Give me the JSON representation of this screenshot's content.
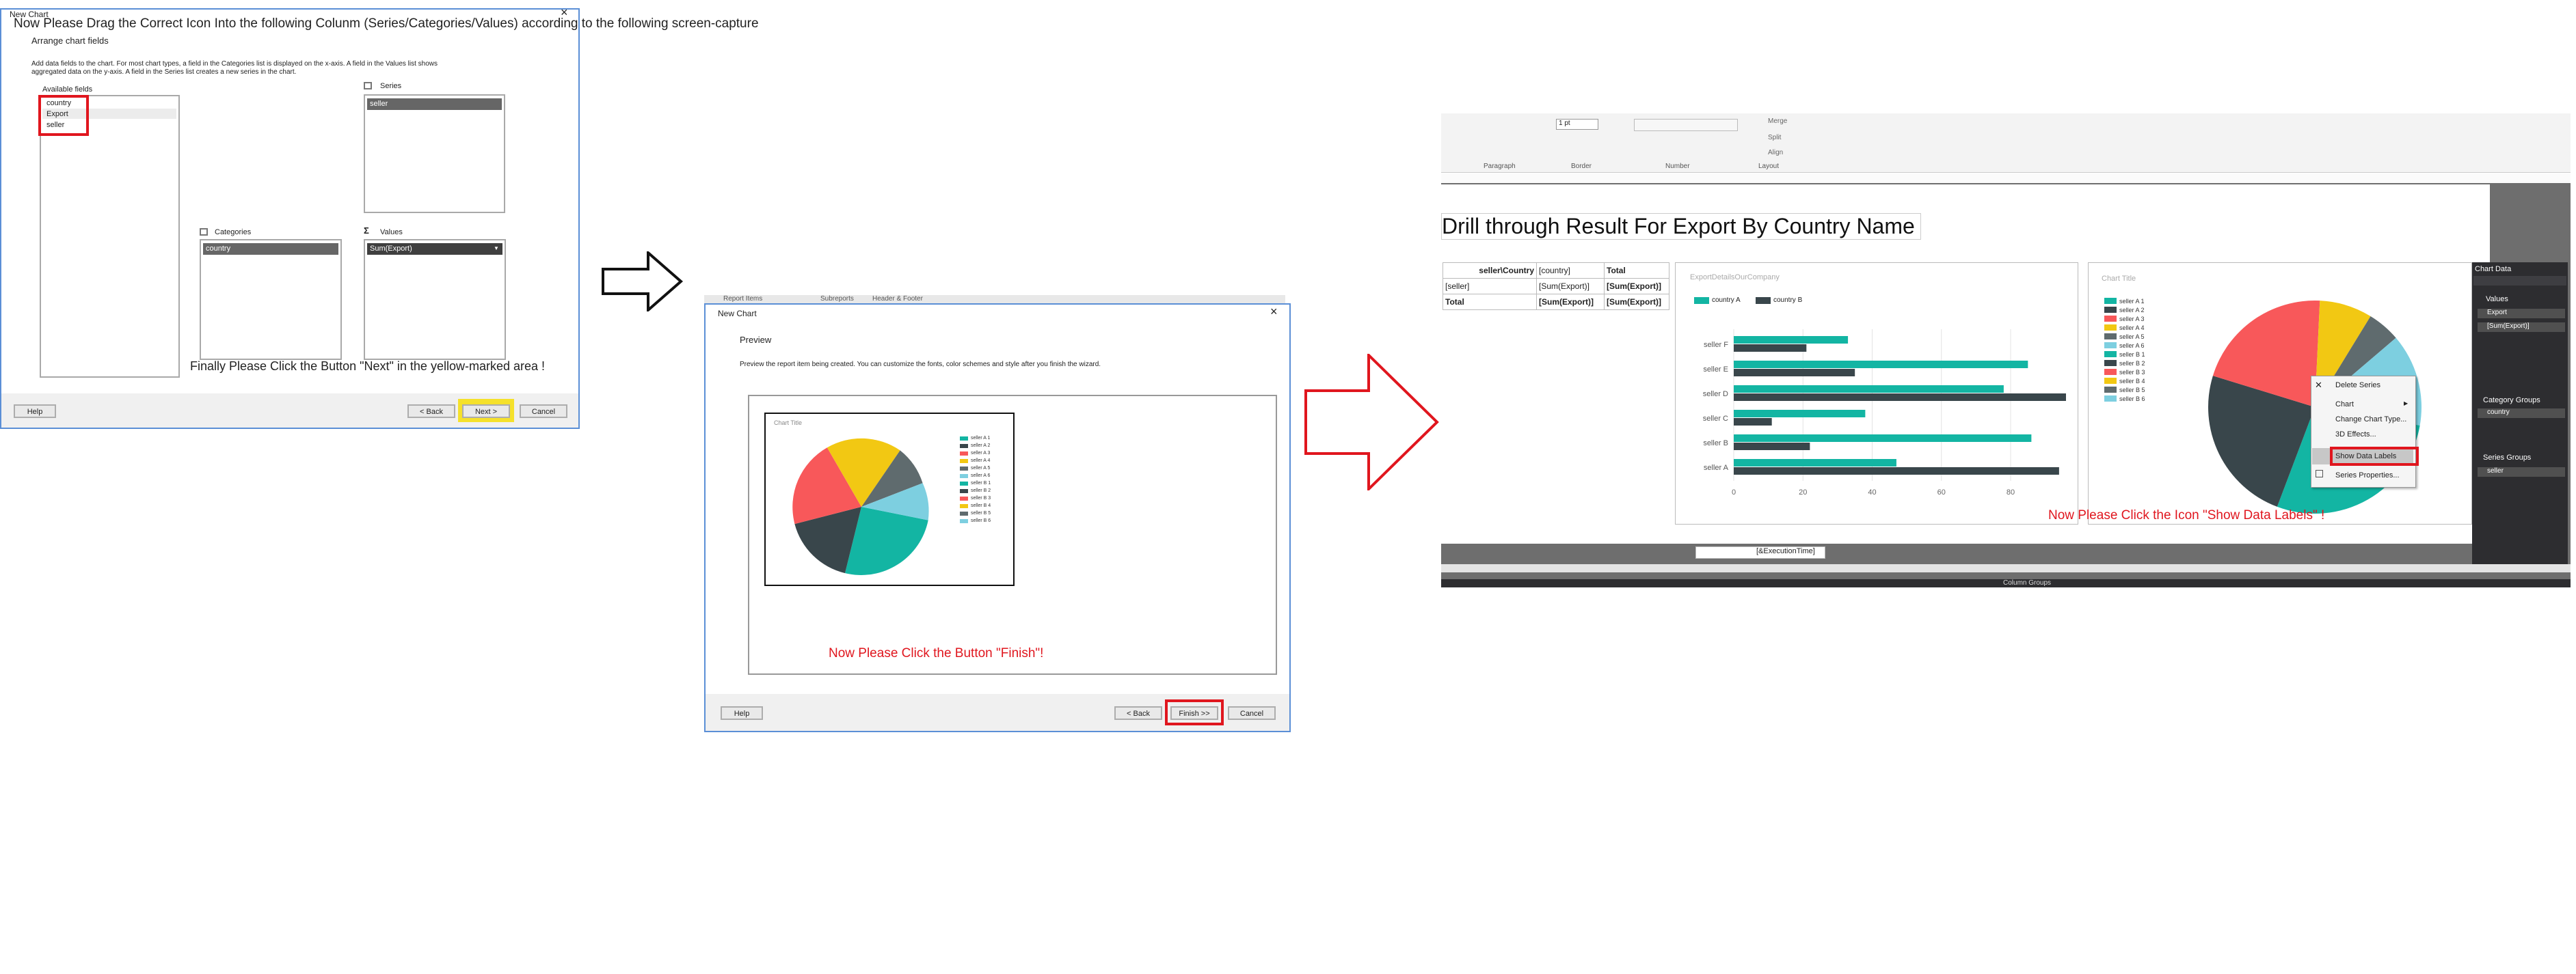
{
  "instructions": {
    "step1": "Now Please Drag the Correct Icon Into the following Colunm (Series/Categories/Values) according to the following screen-capture",
    "step2": "Finally Please Click the Button \"Next\" in the yellow-marked area !",
    "step3": "Now Please Click the Button \"Finish\"!",
    "step4": "Now Please Click the Icon \"Show Data Labels\" !"
  },
  "wizard1": {
    "title": "New Chart",
    "heading": "Arrange chart fields",
    "desc1": "Add data fields to the chart. For most chart types, a field in the Categories list is displayed on the x-axis. A field in the Values list shows",
    "desc2": "aggregated data on the y-axis. A field in the Series list creates a new series in the chart.",
    "available_label": "Available fields",
    "available_fields": [
      "country",
      "Export",
      "seller"
    ],
    "series_label": "Series",
    "series_item": "seller",
    "categories_label": "Categories",
    "categories_item": "country",
    "values_label": "Values",
    "values_item": "Sum(Export)",
    "help": "Help",
    "back": "< Back",
    "next": "Next >",
    "cancel": "Cancel",
    "close": "×"
  },
  "wizard2": {
    "title": "New Chart",
    "bg_tabs": [
      "Report Items",
      "Subreports",
      "Header & Footer"
    ],
    "heading": "Preview",
    "desc": "Preview the report item being created. You can customize the fonts, color schemes and style after you finish the wizard.",
    "chart_title": "Chart Title",
    "help": "Help",
    "back": "< Back",
    "finish": "Finish >>",
    "cancel": "Cancel",
    "close": "×"
  },
  "designer": {
    "ribbon": {
      "border_width": "1 pt",
      "merge": "Merge",
      "split": "Split",
      "align": "Align",
      "groups": [
        "Paragraph",
        "Border",
        "Number",
        "Layout"
      ]
    },
    "report_title": "Drill through Result For Export By Country Name",
    "table": {
      "header": [
        "seller\\Country",
        "[country]",
        "Total"
      ],
      "row1": [
        "[seller]",
        "[Sum(Export)]",
        "[Sum(Export)]"
      ],
      "row2": [
        "Total",
        "[Sum(Export)]",
        "[Sum(Export)]"
      ]
    },
    "footer_field": "[&ExecutionTime]",
    "bar_chart_title": "ExportDetailsOurCompany",
    "pie_chart_title": "Chart Title",
    "context_menu": [
      "Delete Series",
      "Chart",
      "Change Chart Type...",
      "3D Effects...",
      "Show Data Labels",
      "Series Properties..."
    ],
    "chart_data_panel": {
      "title": "Chart Data",
      "values_label": "Values",
      "values_items": [
        "Export",
        "[Sum(Export)]"
      ],
      "category_groups_label": "Category Groups",
      "category_item": "country",
      "series_groups_label": "Series Groups",
      "series_item": "seller"
    },
    "bottom_bar_label": "Column Groups"
  },
  "chart_data": [
    {
      "type": "bar",
      "title": "ExportDetailsOurCompany",
      "categories": [
        "seller F",
        "seller E",
        "seller D",
        "seller C",
        "seller B",
        "seller A"
      ],
      "series": [
        {
          "name": "country A",
          "values": [
            33,
            85,
            78,
            38,
            86,
            47
          ]
        },
        {
          "name": "country B",
          "values": [
            21,
            35,
            96,
            11,
            22,
            94
          ]
        }
      ],
      "xlim": [
        0,
        96
      ],
      "xticks": [
        0,
        20,
        40,
        60,
        80
      ],
      "grid": true,
      "legend": "top"
    },
    {
      "type": "pie",
      "title": "Chart Title",
      "labels": [
        "seller A 1",
        "seller A 2",
        "seller A 3",
        "seller A 4",
        "seller A 5",
        "seller A 6",
        "seller B 1",
        "seller B 2",
        "seller B 3",
        "seller B 4",
        "seller B 5",
        "seller B 6"
      ],
      "values": [
        28,
        24,
        21,
        8,
        5,
        14
      ],
      "legend": "left"
    }
  ],
  "colors": {
    "teal": "#13b5a3",
    "dark": "#39464b",
    "yellow": "#f2c813",
    "red": "#f8585a",
    "grey": "#5f6b6e",
    "light_blue": "#7dcfe0",
    "orange": "#ef8a3b",
    "instruction_red": "#e0161e",
    "highlight_yellow": "#f5e12b"
  }
}
